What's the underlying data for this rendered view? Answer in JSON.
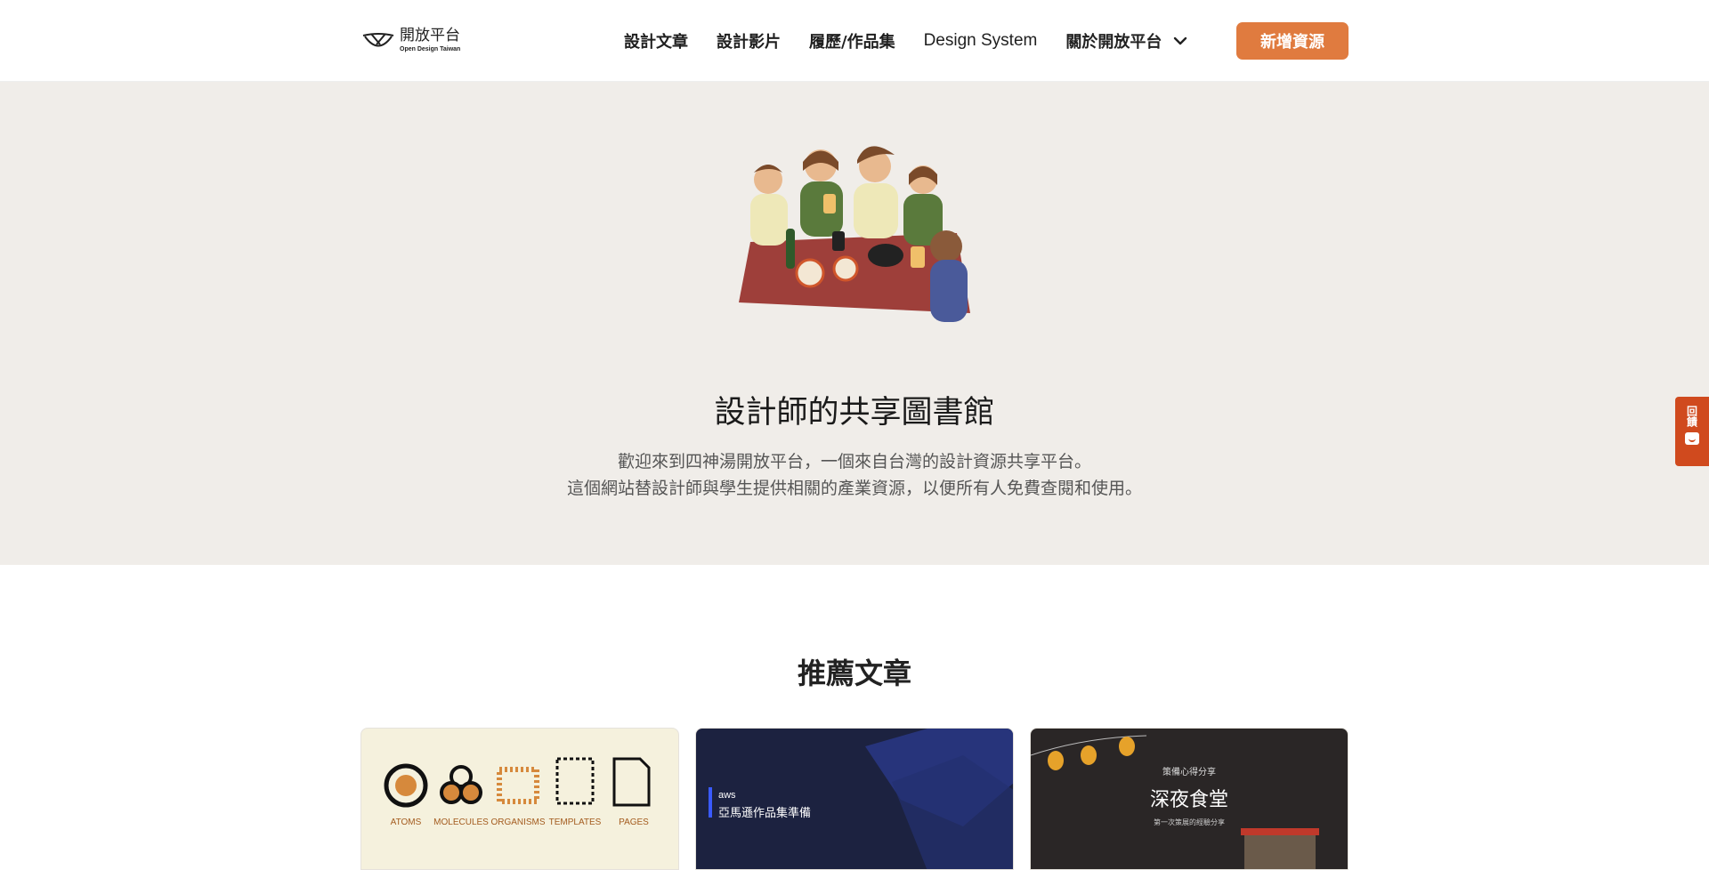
{
  "header": {
    "logo_title": "開放平台",
    "logo_subtitle": "Open Design Taiwan",
    "nav": [
      {
        "label": "設計文章"
      },
      {
        "label": "設計影片"
      },
      {
        "label": "履歷/作品集"
      },
      {
        "label": "Design System"
      },
      {
        "label": "關於開放平台"
      }
    ],
    "cta_label": "新增資源"
  },
  "hero": {
    "title": "設計師的共享圖書館",
    "desc_line1": "歡迎來到四神湯開放平台，一個來自台灣的設計資源共享平台。",
    "desc_line2": "這個網站替設計師與學生提供相關的產業資源，以便所有人免費查閱和使用。"
  },
  "feedback": {
    "label": "回饋"
  },
  "section": {
    "title": "推薦文章"
  },
  "cards": [
    {
      "labels": [
        "ATOMS",
        "MOLECULES",
        "ORGANISMS",
        "TEMPLATES",
        "PAGES"
      ]
    },
    {
      "brand": "aws",
      "title": "亞馬遜作品集準備"
    },
    {
      "kicker": "策備心得分享",
      "title": "深夜食堂",
      "subtitle": "第一次策展的經驗分享"
    }
  ],
  "colors": {
    "accent": "#e07b3f",
    "hero_bg": "#f0ede9",
    "feedback_bg": "#d04a1e"
  },
  "icons": {
    "dropdown": "chevron-down-icon",
    "logo": "bowl-logo-icon"
  }
}
